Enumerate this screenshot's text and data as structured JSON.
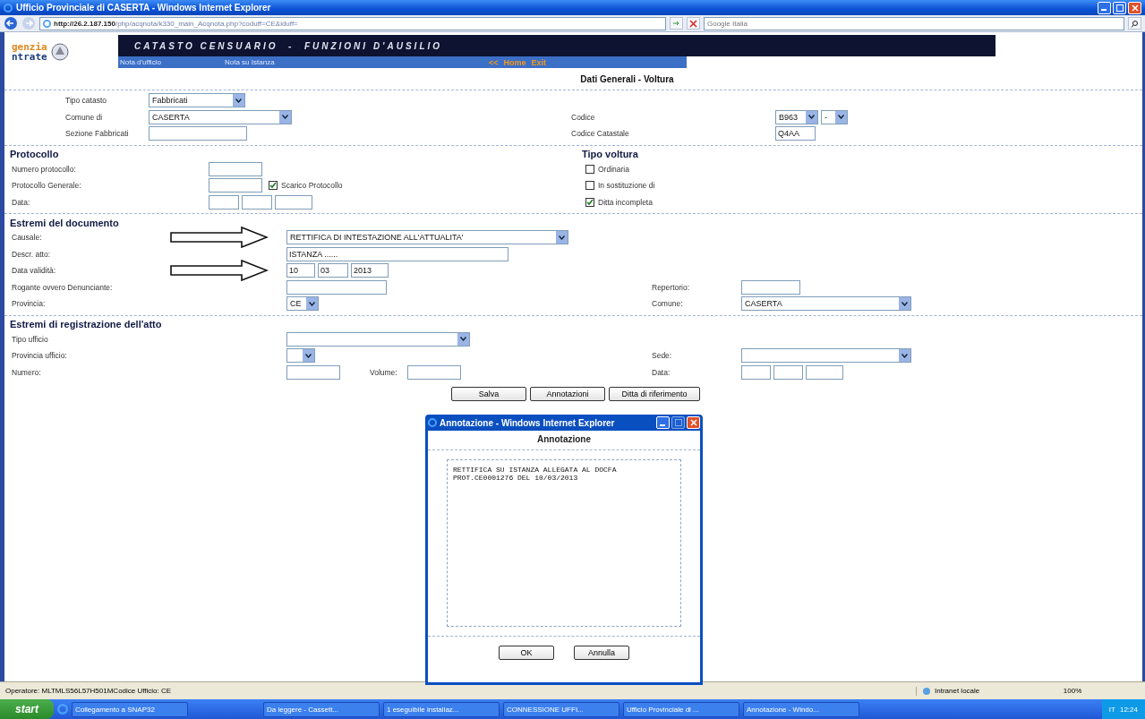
{
  "window": {
    "title": "Ufficio Provinciale di CASERTA - Windows Internet Explorer"
  },
  "address_bar": {
    "url_host": "http://26.2.187.150",
    "url_path": "/php/acqnota/k330_main_Acqnota.php?coduff=CE&iduff=",
    "search_placeholder": "Google Italia"
  },
  "header": {
    "logo_line1": "genzia",
    "logo_line2": "ntrate",
    "title": "CATASTO CENSUARIO  -  FUNZIONI D'AUSILIO",
    "nav": [
      "Nota d'ufficio",
      "Nota su Istanza"
    ],
    "links": [
      "<<",
      "Home",
      "Exit"
    ]
  },
  "page_title": "Dati Generali - Voltura",
  "sections": [
    {
      "kind": "general",
      "rows": [
        {
          "left": {
            "label": "Tipo catasto",
            "controls": [
              {
                "kind": "select",
                "value": "Fabbricati"
              }
            ]
          }
        },
        {
          "left": {
            "label": "Comune di",
            "controls": [
              {
                "kind": "select",
                "value": "CASERTA"
              }
            ]
          },
          "right": {
            "label": "Codice",
            "controls": [
              {
                "kind": "select",
                "value": "B963"
              },
              {
                "kind": "select",
                "value": "-"
              }
            ]
          }
        },
        {
          "left": {
            "label": "Sezione Fabbricati",
            "controls": [
              {
                "kind": "input"
              }
            ]
          },
          "right": {
            "label": "Codice Catastale",
            "controls": [
              {
                "kind": "input",
                "value": "Q4AA"
              }
            ]
          }
        }
      ]
    },
    {
      "kind": "protocol",
      "heading": "Protocollo",
      "right_heading": "Tipo voltura",
      "rows": [
        {
          "left": {
            "label": "Numero protocollo:",
            "controls": [
              {
                "kind": "input"
              }
            ]
          },
          "right": {
            "controls": [
              {
                "kind": "checkbox",
                "label": "Ordinaria",
                "checked": false
              }
            ]
          }
        },
        {
          "left": {
            "label": "Protocollo Generale:",
            "controls": [
              {
                "kind": "input"
              },
              {
                "kind": "checkbox",
                "label": "Scarico Protocollo",
                "checked": true
              }
            ]
          },
          "right": {
            "controls": [
              {
                "kind": "checkbox",
                "label": "In sostituzione di",
                "checked": false
              }
            ]
          }
        },
        {
          "left": {
            "label": "Data:",
            "controls": [
              {
                "kind": "input"
              },
              {
                "kind": "input"
              },
              {
                "kind": "input"
              }
            ]
          },
          "right": {
            "controls": [
              {
                "kind": "checkbox",
                "label": "Ditta incompleta",
                "checked": true
              }
            ]
          }
        }
      ]
    },
    {
      "kind": "document",
      "heading": "Estremi del documento",
      "rows": [
        {
          "marked": true,
          "left": {
            "label": "Causale:",
            "controls": [
              {
                "kind": "select",
                "value": "RETTIFICA DI INTESTAZIONE ALL'ATTUALITA'"
              }
            ]
          }
        },
        {
          "marked": false,
          "left": {
            "label": "Descr. atto:",
            "controls": [
              {
                "kind": "input",
                "value": "ISTANZA ......"
              }
            ]
          }
        },
        {
          "marked": true,
          "left": {
            "label": "Data validità:",
            "controls": [
              {
                "kind": "input",
                "value": "10"
              },
              {
                "kind": "input",
                "value": "03"
              },
              {
                "kind": "input",
                "value": "2013"
              }
            ]
          }
        },
        {
          "marked": false,
          "left": {
            "label": "Rogante ovvero Denunciante:",
            "controls": [
              {
                "kind": "input"
              }
            ]
          },
          "right": {
            "label": "Repertorio:",
            "controls": [
              {
                "kind": "input"
              }
            ]
          }
        },
        {
          "marked": false,
          "left": {
            "label": "Provincia:",
            "controls": [
              {
                "kind": "select",
                "value": "CE"
              }
            ]
          },
          "right": {
            "label": "Comune:",
            "controls": [
              {
                "kind": "select",
                "value": "CASERTA"
              }
            ]
          }
        }
      ]
    },
    {
      "kind": "registration",
      "heading": "Estremi di registrazione dell'atto",
      "rows": [
        {
          "left": {
            "label": "Tipo ufficio",
            "controls": [
              {
                "kind": "select"
              }
            ]
          }
        },
        {
          "left": {
            "label": "Provincia ufficio:",
            "controls": [
              {
                "kind": "select"
              }
            ]
          },
          "right": {
            "label": "Sede:",
            "controls": [
              {
                "kind": "select"
              }
            ]
          }
        },
        {
          "left": {
            "label": "Numero:",
            "controls": [
              {
                "kind": "input"
              },
              {
                "kind": "label",
                "label": "Volume:"
              },
              {
                "kind": "input"
              }
            ]
          },
          "right": {
            "label": "Data:",
            "controls": [
              {
                "kind": "input"
              },
              {
                "kind": "input"
              },
              {
                "kind": "input"
              }
            ]
          }
        }
      ]
    }
  ],
  "buttons": [
    "Salva",
    "Annotazioni",
    "Ditta di riferimento"
  ],
  "dialog": {
    "title": "Annotazione - Windows Internet Explorer",
    "heading": "Annotazione",
    "text": "RETTIFICA SU ISTANZA ALLEGATA AL DOCFA\nPROT.CE0001276 DEL 10/03/2013",
    "buttons": [
      "OK",
      "Annulla"
    ]
  },
  "status_bar": {
    "text": "Operatore: MLTMLS56L57H501MCodice Ufficio: CE",
    "zone": "Intranet locale",
    "zoom": "100%"
  },
  "taskbar": {
    "start": "start",
    "items": [
      "Collegamento a SNAP32",
      "Da leggere - Cassett...",
      "1 eseguibile installaz...",
      "CONNESSIONE UFFI...",
      "Ufficio Provinciale di ...",
      "Annotazione - Windo..."
    ],
    "language": "IT",
    "clock": "12:24"
  }
}
